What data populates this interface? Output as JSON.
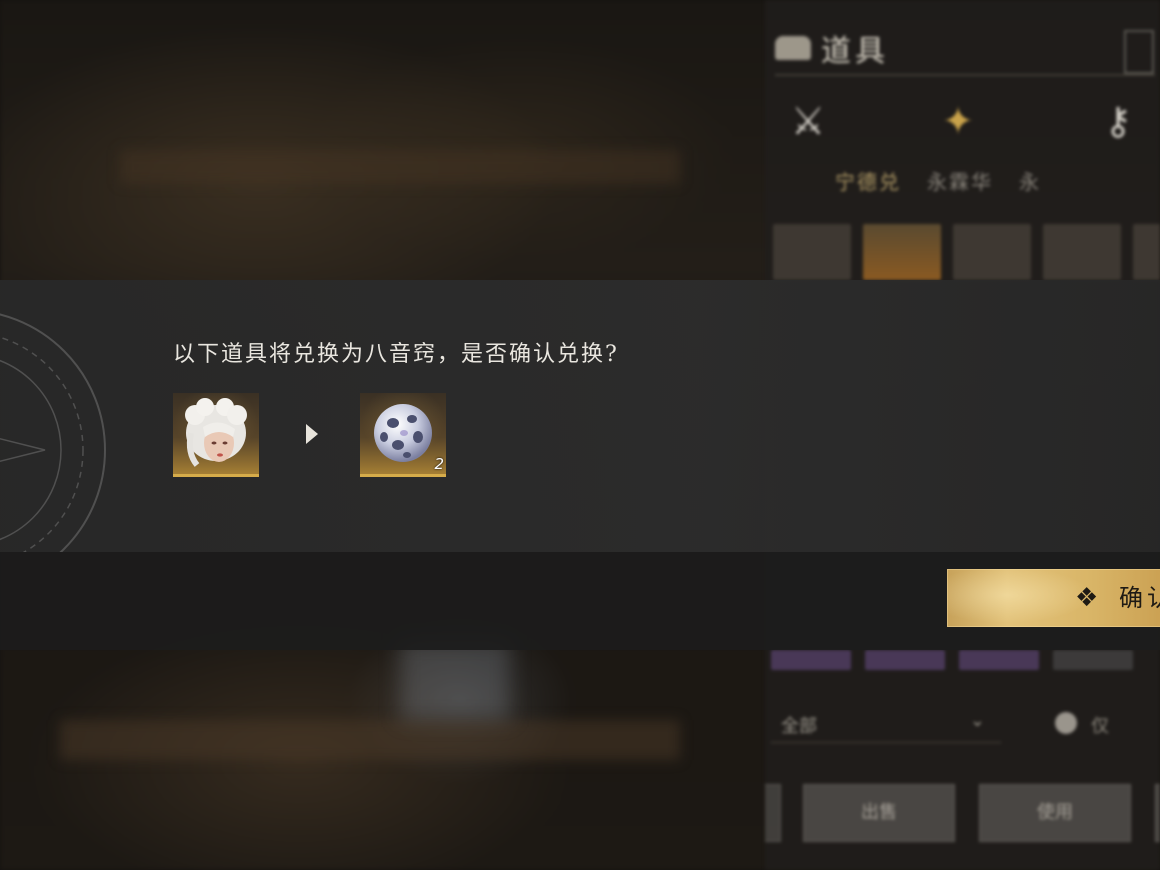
{
  "inventory": {
    "title": "道具",
    "sub_tabs": [
      "宁德兑",
      "永霖华",
      "永"
    ],
    "filter_label": "全部",
    "toggle_label": "仅",
    "buttons": [
      "出售",
      "使用",
      ""
    ]
  },
  "dialog": {
    "prompt": "以下道具将兑换为八音窍，是否确认兑换?",
    "source_item": {
      "name": "hairstyle-item",
      "count": ""
    },
    "target_item": {
      "name": "bayinqiao-sphere",
      "count": "2"
    },
    "confirm_icon": "❖",
    "confirm_label": "确认"
  },
  "colors": {
    "gold_accent": "#d6ac4a",
    "button_gold": "#dcb96e",
    "text_light": "#e9e6df",
    "band": "#2c2c2c"
  },
  "icons": [
    "bag-icon",
    "weapon-icon",
    "ornament-icon",
    "key-icon",
    "play-arrow-icon",
    "diamond-cluster-icon"
  ]
}
